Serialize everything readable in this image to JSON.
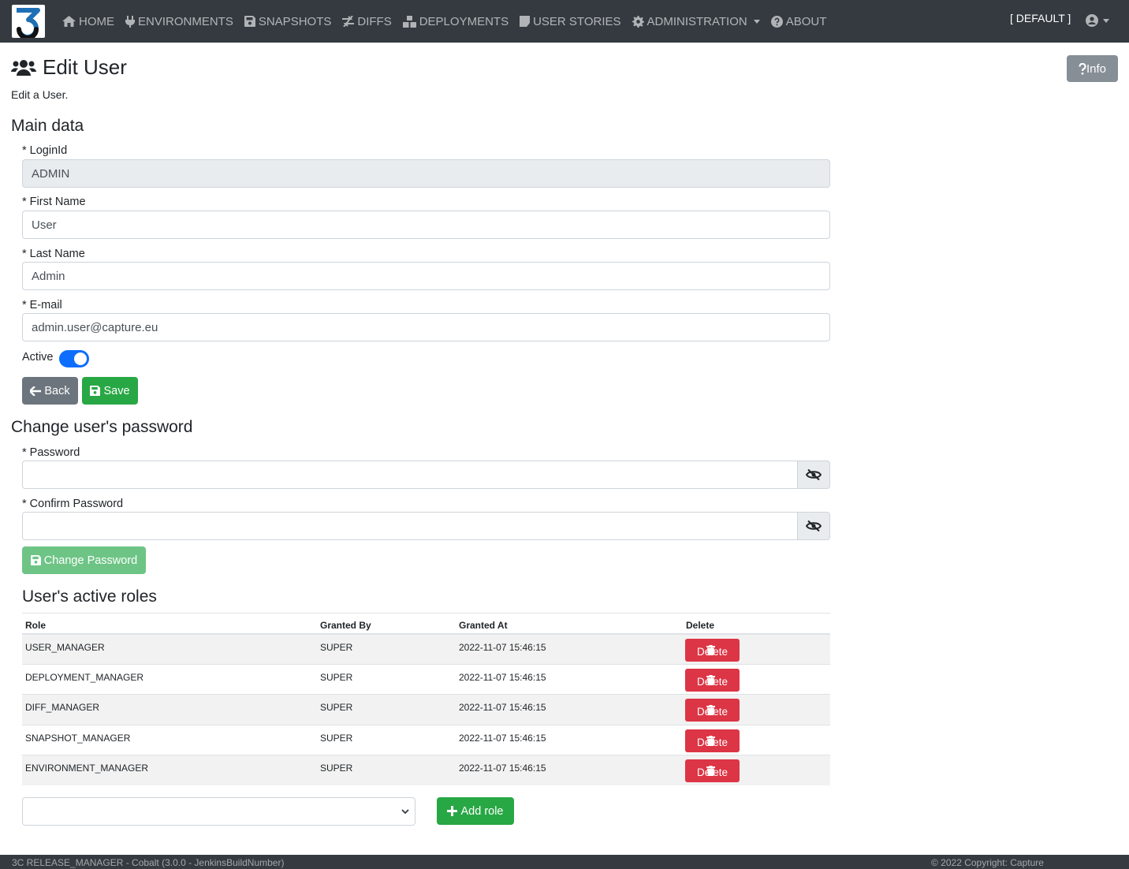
{
  "nav": {
    "items": [
      {
        "label": "HOME",
        "icon": "home-icon"
      },
      {
        "label": "ENVIRONMENTS",
        "icon": "plug-icon"
      },
      {
        "label": "SNAPSHOTS",
        "icon": "save-icon"
      },
      {
        "label": "DIFFS",
        "icon": "exchange-icon"
      },
      {
        "label": "DEPLOYMENTS",
        "icon": "boxes-icon"
      },
      {
        "label": "USER STORIES",
        "icon": "sticky-note-icon"
      },
      {
        "label": "ADMINISTRATION",
        "icon": "gear-icon"
      },
      {
        "label": "ABOUT",
        "icon": "question-circle-icon"
      }
    ],
    "environment": "[ DEFAULT ]"
  },
  "header": {
    "title": "Edit User",
    "subtitle": "Edit a User.",
    "info_label": "Info"
  },
  "main_data": {
    "heading": "Main data",
    "login_label": "* LoginId",
    "login_value": "ADMIN",
    "first_name_label": "* First Name",
    "first_name_value": "User",
    "last_name_label": "* Last Name",
    "last_name_value": "Admin",
    "email_label": "* E-mail",
    "email_value": "admin.user@capture.eu",
    "active_label": "Active",
    "active": true,
    "back_label": "Back",
    "save_label": "Save"
  },
  "password": {
    "heading": "Change user's password",
    "password_label": "* Password",
    "confirm_label": "* Confirm Password",
    "change_label": "Change Password"
  },
  "roles": {
    "heading": "User's active roles",
    "columns": [
      "Role",
      "Granted By",
      "Granted At",
      "Delete"
    ],
    "rows": [
      {
        "role": "USER_MANAGER",
        "granted_by": "SUPER",
        "granted_at": "2022-11-07 15:46:15"
      },
      {
        "role": "DEPLOYMENT_MANAGER",
        "granted_by": "SUPER",
        "granted_at": "2022-11-07 15:46:15"
      },
      {
        "role": "DIFF_MANAGER",
        "granted_by": "SUPER",
        "granted_at": "2022-11-07 15:46:15"
      },
      {
        "role": "SNAPSHOT_MANAGER",
        "granted_by": "SUPER",
        "granted_at": "2022-11-07 15:46:15"
      },
      {
        "role": "ENVIRONMENT_MANAGER",
        "granted_by": "SUPER",
        "granted_at": "2022-11-07 15:46:15"
      }
    ],
    "delete_label": "Delete",
    "add_label": "Add role"
  },
  "footer": {
    "left": "3C RELEASE_MANAGER - Cobalt (3.0.0 - JenkinsBuildNumber)",
    "right": "© 2022 Copyright: Capture"
  },
  "colors": {
    "navbar": "#343a40",
    "primary": "#0d6efd",
    "success": "#28a745",
    "danger": "#dc3545",
    "secondary": "#6c757d"
  }
}
